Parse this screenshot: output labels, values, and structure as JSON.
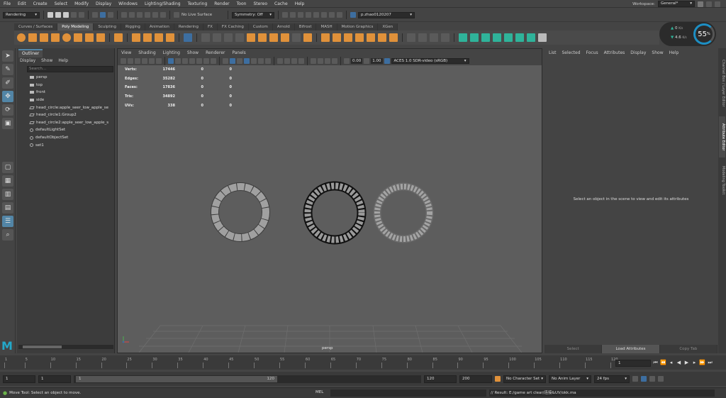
{
  "menubar": {
    "items": [
      "File",
      "Edit",
      "Create",
      "Select",
      "Modify",
      "Display",
      "Windows",
      "Lighting/Shading",
      "Texturing",
      "Render",
      "Toon",
      "Stereo",
      "Cache",
      "Help"
    ],
    "workspace_label": "Workspace:",
    "workspace_value": "General*"
  },
  "statusline": {
    "menuset": "Rendering",
    "live_surface": "No Live Surface",
    "symmetry": "Symmetry: Off",
    "user": "p.zhao0120207"
  },
  "shelf": {
    "tabs": [
      "Curves / Surfaces",
      "Poly Modeling",
      "Sculpting",
      "Rigging",
      "Animation",
      "Rendering",
      "FX",
      "FX Caching",
      "Custom",
      "Arnold",
      "Bifrost",
      "MASH",
      "Motion Graphics",
      "XGen"
    ],
    "active_tab": "Poly Modeling"
  },
  "perf": {
    "up": "0",
    "up_unit": "K/s",
    "down": "4.6",
    "down_unit": "K/s",
    "percent": "55",
    "percent_sign": "%"
  },
  "outliner": {
    "title": "Outliner",
    "menu": [
      "Display",
      "Show",
      "Help"
    ],
    "search_placeholder": "Search...",
    "items": [
      {
        "label": "persp",
        "icon": "camera-icon"
      },
      {
        "label": "top",
        "icon": "camera-icon"
      },
      {
        "label": "front",
        "icon": "camera-icon"
      },
      {
        "label": "side",
        "icon": "camera-icon"
      },
      {
        "label": "head_circle:apple_seer_low_apple_se",
        "icon": "group-icon"
      },
      {
        "label": "head_circle1:Group2",
        "icon": "group-icon"
      },
      {
        "label": "head_circle2:apple_seer_low_apple_s",
        "icon": "group-icon"
      },
      {
        "label": "defaultLightSet",
        "icon": "set-icon"
      },
      {
        "label": "defaultObjectSet",
        "icon": "set-icon"
      },
      {
        "label": "set1",
        "icon": "set-icon"
      }
    ]
  },
  "viewport": {
    "menu": [
      "View",
      "Shading",
      "Lighting",
      "Show",
      "Renderer",
      "Panels"
    ],
    "exposure": "0.00",
    "gamma": "1.00",
    "colorspace": "ACES 1.0 SDR-video (sRGB)",
    "camera": "persp",
    "hud": [
      {
        "label": "Verts:",
        "a": "17446",
        "b": "0",
        "c": "0"
      },
      {
        "label": "Edges:",
        "a": "35282",
        "b": "0",
        "c": "0"
      },
      {
        "label": "Faces:",
        "a": "17836",
        "b": "0",
        "c": "0"
      },
      {
        "label": "Tris:",
        "a": "34892",
        "b": "0",
        "c": "0"
      },
      {
        "label": "UVs:",
        "a": "338",
        "b": "0",
        "c": "0"
      }
    ]
  },
  "attr": {
    "menu": [
      "List",
      "Selected",
      "Focus",
      "Attributes",
      "Display",
      "Show",
      "Help"
    ],
    "message": "Select an object in the scene to view and edit its attributes",
    "buttons": [
      "Select",
      "Load Attributes",
      "Copy Tab"
    ]
  },
  "side_tabs": [
    "Channel Box / Layer Editor",
    "Attribute Editor",
    "Modeling Toolkit"
  ],
  "timeline": {
    "ticks": [
      "1",
      "5",
      "10",
      "15",
      "20",
      "25",
      "30",
      "35",
      "40",
      "45",
      "50",
      "55",
      "60",
      "65",
      "70",
      "75",
      "80",
      "85",
      "90",
      "95",
      "100",
      "105",
      "110",
      "115",
      "120"
    ],
    "current_frame": "1"
  },
  "range": {
    "start": "1",
    "inner_start": "1",
    "slider_start": "1",
    "slider_end": "120",
    "end": "120",
    "anim_end": "200",
    "char_set": "No Character Set",
    "anim_layer": "No Anim Layer",
    "fps": "24 fps"
  },
  "cmdline": {
    "help": "Move Tool: Select an object to move.",
    "mel": "MEL",
    "result": "// Result: E:/game art clear/连接&UV/okk.ma"
  },
  "colors": {
    "accent_blue": "#5285a6",
    "shelf_orange": "#e0913a",
    "perf_ring": "#1d8fc4",
    "maya_logo": "#23a8c9"
  }
}
